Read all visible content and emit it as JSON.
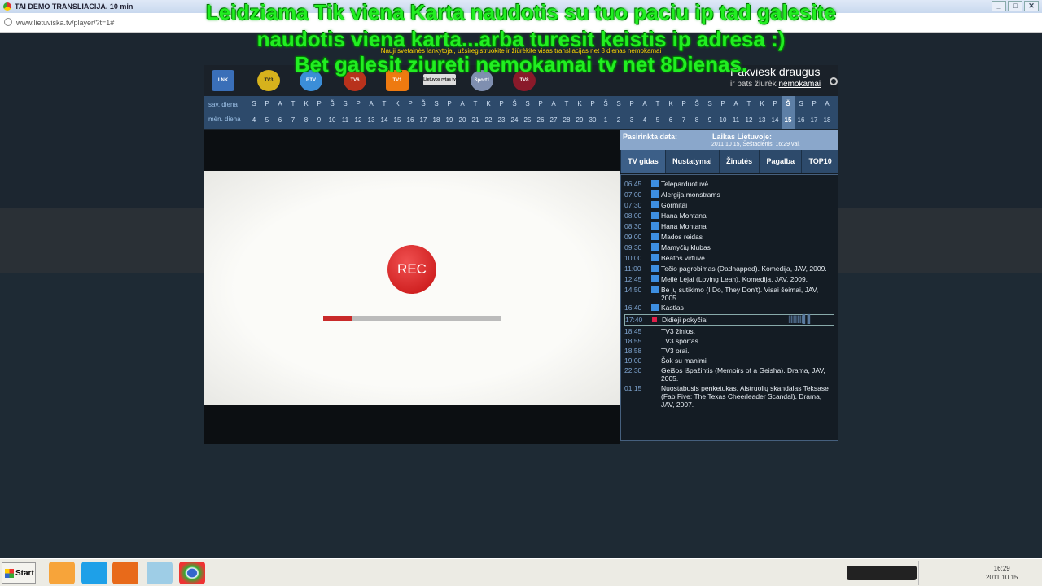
{
  "window": {
    "title": "TAI DEMO TRANSLIACIJA. 10 min",
    "url": "www.lietuviska.tv/player/?t=1#"
  },
  "overlay": [
    "Leidziama Tik viena Karta naudotis su tuo paciu ip tad galesite",
    "naudotis viena karta...arba turesit keistis ip adresa :)",
    "Bet galesit ziureti nemokamai tv net 8Dienas."
  ],
  "notice": "Nauji svetainės lankytojai, užsiregistruokite ir žiūrėkite visas transliacijas net 8 dienas nemokamai",
  "channels": [
    "LNK",
    "TV3",
    "BTV",
    "TV6",
    "TV1",
    "Lietuvos rytas tv",
    "Sport1",
    "TV8"
  ],
  "invite": {
    "title": "Pakviesk draugus",
    "sub": "ir pats žiūrėk",
    "link": "nemokamai"
  },
  "calendar": {
    "weekday_label": "sav. diena",
    "day_label": "mėn. diena",
    "weekdays": [
      "S",
      "P",
      "A",
      "T",
      "K",
      "P",
      "Š"
    ],
    "days": [
      4,
      5,
      6,
      7,
      8,
      9,
      10,
      11,
      12,
      13,
      14,
      15,
      16,
      17,
      18,
      19,
      20,
      21,
      22,
      23,
      24,
      25,
      26,
      27,
      28,
      29,
      30,
      1,
      2,
      3,
      4,
      5,
      6,
      7,
      8,
      9,
      10,
      11,
      12,
      13,
      14,
      15,
      16,
      17,
      18
    ],
    "selected_index": 41
  },
  "player": {
    "rec_label": "REC",
    "progress": 0.16,
    "colors": {
      "rec": "#c41010"
    }
  },
  "panel": {
    "selected_date_label": "Pasirinkta data:",
    "time_label": "Laikas Lietuvoje:",
    "time_value": "2011 10 15, Šeštadienis, 16:29 val.",
    "tabs": [
      "TV gidas",
      "Nustatymai",
      "Žinutės",
      "Pagalba",
      "TOP10"
    ],
    "guide": [
      {
        "time": "06:45",
        "title": "Teleparduotuvė",
        "rec": true
      },
      {
        "time": "07:00",
        "title": "Alergija monstrams",
        "rec": true
      },
      {
        "time": "07:30",
        "title": "Gormitai",
        "rec": true
      },
      {
        "time": "08:00",
        "title": "Hana Montana",
        "rec": true
      },
      {
        "time": "08:30",
        "title": "Hana Montana",
        "rec": true
      },
      {
        "time": "09:00",
        "title": "Mados reidas",
        "rec": true
      },
      {
        "time": "09:30",
        "title": "Mamyčių klubas",
        "rec": true
      },
      {
        "time": "10:00",
        "title": "Beatos virtuvė",
        "rec": true
      },
      {
        "time": "11:00",
        "title": "Tečio pagrobimas (Dadnapped). Komedija, JAV, 2009.",
        "rec": true
      },
      {
        "time": "12:45",
        "title": "Meilė Lėjai (Loving Leah). Komedija, JAV, 2009.",
        "rec": true
      },
      {
        "time": "14:50",
        "title": "Be jų sutikimo (I Do, They Don't). Visai šeimai, JAV, 2005.",
        "rec": true
      },
      {
        "time": "16:40",
        "title": "Kastlas",
        "rec": true
      },
      {
        "time": "17:40",
        "title": "Didieji pokyčiai",
        "live": true
      },
      {
        "time": "18:45",
        "title": "TV3 žinios."
      },
      {
        "time": "18:55",
        "title": "TV3 sportas."
      },
      {
        "time": "18:58",
        "title": "TV3 orai."
      },
      {
        "time": "19:00",
        "title": "Šok su manimi"
      },
      {
        "time": "22:30",
        "title": "Geišos išpažintis (Memoirs of a Geisha). Drama, JAV, 2005."
      },
      {
        "time": "01:15",
        "title": "Nuostabusis penketukas. Aistruolių skandalas Teksase (Fab Five: The Texas Cheerleader Scandal). Drama, JAV, 2007."
      }
    ]
  },
  "taskbar": {
    "start": "Start",
    "clock_time": "16:29",
    "clock_date": "2011.10.15"
  }
}
